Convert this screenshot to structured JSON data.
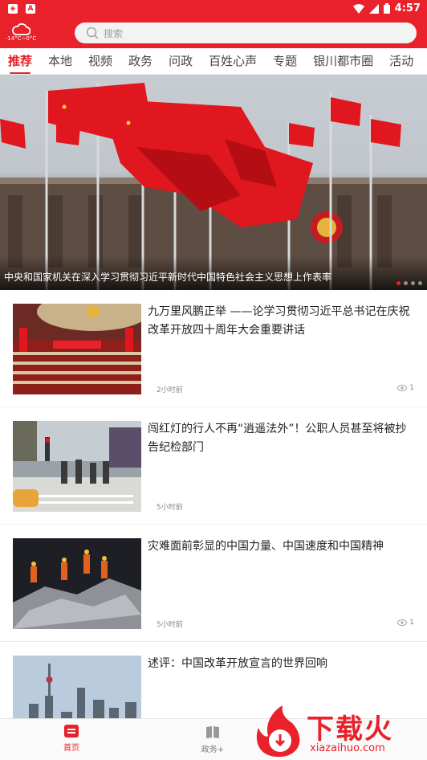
{
  "status_bar": {
    "time": "4:57"
  },
  "header": {
    "weather_temp": "-14°C~0°C",
    "search_placeholder": "搜索"
  },
  "tabs": [
    "推荐",
    "本地",
    "视频",
    "政务",
    "问政",
    "百姓心声",
    "专题",
    "银川都市圈",
    "活动"
  ],
  "active_tab": "推荐",
  "banner": {
    "caption": "中央和国家机关在深入学习贯彻习近平新时代中国特色社会主义思想上作表率",
    "slide_count": 4,
    "active_slide": 1
  },
  "news": [
    {
      "title": "九万里风鹏正举 ——论学习贯彻习近平总书记在庆祝改革开放四十周年大会重要讲话",
      "time": "2小时前",
      "views": "1"
    },
    {
      "title": "闯红灯的行人不再“逍遥法外”！公职人员甚至将被抄告纪检部门",
      "time": "5小时前",
      "views": ""
    },
    {
      "title": "灾难面前彰显的中国力量、中国速度和中国精神",
      "time": "5小时前",
      "views": "1"
    },
    {
      "title": "述评：中国改革开放宣言的世界回响",
      "time": "",
      "views": ""
    }
  ],
  "bottom_nav": {
    "home_label": "首页",
    "gov_label": "政务+"
  },
  "watermark": {
    "text": "下载火",
    "url": "xiazaihuo.com"
  },
  "colors": {
    "accent": "#e8212a"
  }
}
